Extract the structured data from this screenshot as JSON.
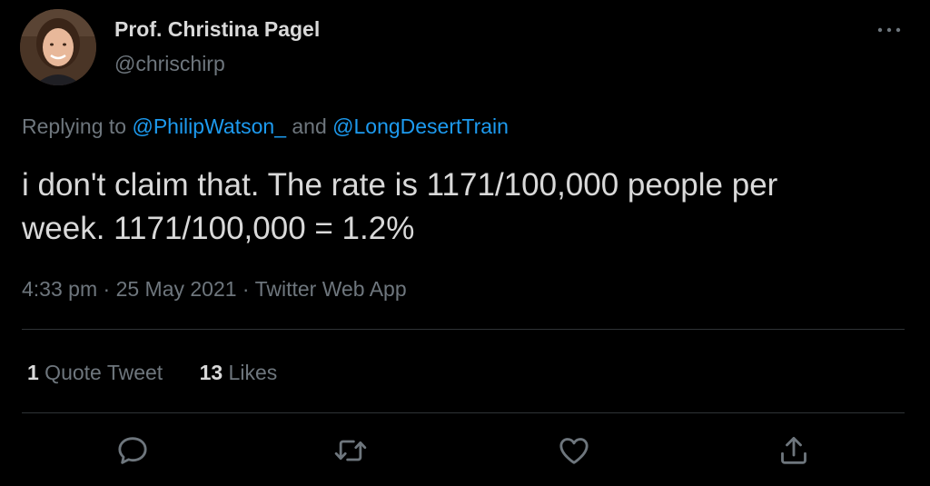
{
  "author": {
    "name": "Prof. Christina Pagel",
    "handle": "@chrischirp"
  },
  "reply": {
    "prefix": "Replying to ",
    "mention1": "@PhilipWatson_",
    "conjunction": " and ",
    "mention2": "@LongDesertTrain"
  },
  "tweet": {
    "line1": "i don't claim that. The rate is 1171/100,000 people per",
    "line2": "week. 1171/100,000 = 1.2%"
  },
  "meta": {
    "time": "4:33 pm",
    "sep1": " · ",
    "date": "25 May 2021",
    "sep2": " · ",
    "source": "Twitter Web App"
  },
  "stats": {
    "quote_count": "1",
    "quote_label": " Quote Tweet",
    "likes_count": "13",
    "likes_label": " Likes"
  },
  "icons": {
    "more": "more-horizontal-icon",
    "reply": "reply-bubble-icon",
    "retweet": "retweet-icon",
    "like": "heart-icon",
    "share": "share-icon"
  },
  "colors": {
    "background": "#000000",
    "text": "#d9d9d9",
    "secondary": "#6e767d",
    "link": "#1d9bf0",
    "divider": "#2f3336"
  }
}
